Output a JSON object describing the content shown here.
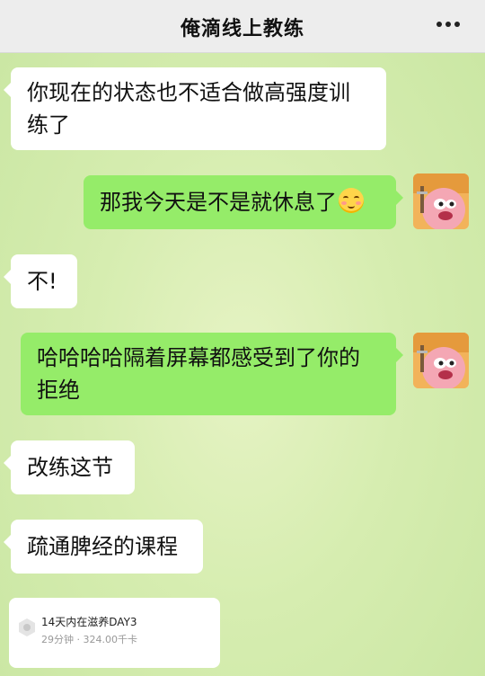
{
  "header": {
    "title": "俺滴线上教练",
    "more_icon": "more-dots-icon"
  },
  "messages": [
    {
      "side": "left",
      "text": "你现在的状态也不适合做高强度训练了"
    },
    {
      "side": "right",
      "text": "那我今天是不是就休息了",
      "emoji": "blushing-smile-emoji"
    },
    {
      "side": "left",
      "text": "不!"
    },
    {
      "side": "right",
      "text": "哈哈哈哈隔着屏幕都感受到了你的拒绝"
    },
    {
      "side": "left",
      "text": "改练这节"
    },
    {
      "side": "left",
      "text": "疏通脾经的课程"
    }
  ],
  "card": {
    "title": "14天内在滋养DAY3",
    "meta": "29分钟 · 324.00千卡",
    "icon": "app-logo-icon"
  },
  "colors": {
    "header_bg": "#ededed",
    "bubble_left": "#ffffff",
    "bubble_right": "#95ec69",
    "chat_bg": "#d6edb0"
  }
}
